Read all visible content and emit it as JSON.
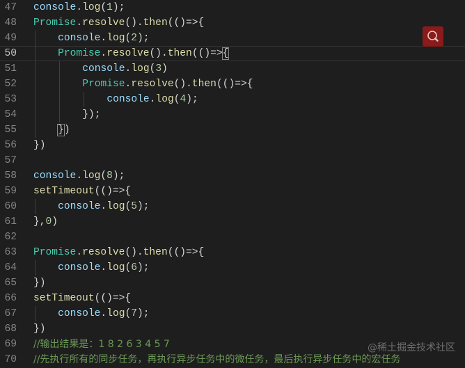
{
  "editor": {
    "current_line": 50,
    "lines": [
      {
        "num": 47,
        "indent": 0,
        "tokens": [
          [
            "console",
            "var"
          ],
          [
            ".",
            "pun"
          ],
          [
            "log",
            "fn"
          ],
          [
            "(",
            "pun"
          ],
          [
            "1",
            "num"
          ],
          [
            ");",
            "pun"
          ]
        ]
      },
      {
        "num": 48,
        "indent": 0,
        "tokens": [
          [
            "Promise",
            "cls"
          ],
          [
            ".",
            "pun"
          ],
          [
            "resolve",
            "fn"
          ],
          [
            "().",
            "pun"
          ],
          [
            "then",
            "fn"
          ],
          [
            "(()",
            "pun"
          ],
          [
            "=>",
            "op"
          ],
          [
            "{",
            "pun"
          ]
        ]
      },
      {
        "num": 49,
        "indent": 1,
        "tokens": [
          [
            "console",
            "var"
          ],
          [
            ".",
            "pun"
          ],
          [
            "log",
            "fn"
          ],
          [
            "(",
            "pun"
          ],
          [
            "2",
            "num"
          ],
          [
            ");",
            "pun"
          ]
        ]
      },
      {
        "num": 50,
        "indent": 1,
        "tokens": [
          [
            "Promise",
            "cls"
          ],
          [
            ".",
            "pun"
          ],
          [
            "resolve",
            "fn"
          ],
          [
            "().",
            "pun"
          ],
          [
            "then",
            "fn"
          ],
          [
            "(()",
            "pun"
          ],
          [
            "=>",
            "op"
          ],
          [
            "{",
            "pun",
            "match"
          ]
        ]
      },
      {
        "num": 51,
        "indent": 2,
        "tokens": [
          [
            "console",
            "var"
          ],
          [
            ".",
            "pun"
          ],
          [
            "log",
            "fn"
          ],
          [
            "(",
            "pun"
          ],
          [
            "3",
            "num"
          ],
          [
            ")",
            "pun"
          ]
        ]
      },
      {
        "num": 52,
        "indent": 2,
        "tokens": [
          [
            "Promise",
            "cls"
          ],
          [
            ".",
            "pun"
          ],
          [
            "resolve",
            "fn"
          ],
          [
            "().",
            "pun"
          ],
          [
            "then",
            "fn"
          ],
          [
            "(()",
            "pun"
          ],
          [
            "=>",
            "op"
          ],
          [
            "{",
            "pun"
          ]
        ]
      },
      {
        "num": 53,
        "indent": 3,
        "tokens": [
          [
            "console",
            "var"
          ],
          [
            ".",
            "pun"
          ],
          [
            "log",
            "fn"
          ],
          [
            "(",
            "pun"
          ],
          [
            "4",
            "num"
          ],
          [
            ");",
            "pun"
          ]
        ]
      },
      {
        "num": 54,
        "indent": 2,
        "tokens": [
          [
            "});",
            "pun"
          ]
        ]
      },
      {
        "num": 55,
        "indent": 1,
        "tokens": [
          [
            "}",
            "pun",
            "match"
          ],
          [
            ")",
            "pun"
          ]
        ]
      },
      {
        "num": 56,
        "indent": 0,
        "tokens": [
          [
            "})",
            "pun"
          ]
        ]
      },
      {
        "num": 57,
        "indent": 0,
        "tokens": []
      },
      {
        "num": 58,
        "indent": 0,
        "tokens": [
          [
            "console",
            "var"
          ],
          [
            ".",
            "pun"
          ],
          [
            "log",
            "fn"
          ],
          [
            "(",
            "pun"
          ],
          [
            "8",
            "num"
          ],
          [
            ");",
            "pun"
          ]
        ]
      },
      {
        "num": 59,
        "indent": 0,
        "tokens": [
          [
            "setTimeout",
            "fn"
          ],
          [
            "(()",
            "pun"
          ],
          [
            "=>",
            "op"
          ],
          [
            "{",
            "pun"
          ]
        ]
      },
      {
        "num": 60,
        "indent": 1,
        "tokens": [
          [
            "console",
            "var"
          ],
          [
            ".",
            "pun"
          ],
          [
            "log",
            "fn"
          ],
          [
            "(",
            "pun"
          ],
          [
            "5",
            "num"
          ],
          [
            ");",
            "pun"
          ]
        ]
      },
      {
        "num": 61,
        "indent": 0,
        "tokens": [
          [
            "},",
            "pun"
          ],
          [
            "0",
            "num"
          ],
          [
            ")",
            "pun"
          ]
        ]
      },
      {
        "num": 62,
        "indent": 0,
        "tokens": []
      },
      {
        "num": 63,
        "indent": 0,
        "tokens": [
          [
            "Promise",
            "cls"
          ],
          [
            ".",
            "pun"
          ],
          [
            "resolve",
            "fn"
          ],
          [
            "().",
            "pun"
          ],
          [
            "then",
            "fn"
          ],
          [
            "(()",
            "pun"
          ],
          [
            "=>",
            "op"
          ],
          [
            "{",
            "pun"
          ]
        ]
      },
      {
        "num": 64,
        "indent": 1,
        "tokens": [
          [
            "console",
            "var"
          ],
          [
            ".",
            "pun"
          ],
          [
            "log",
            "fn"
          ],
          [
            "(",
            "pun"
          ],
          [
            "6",
            "num"
          ],
          [
            ");",
            "pun"
          ]
        ]
      },
      {
        "num": 65,
        "indent": 0,
        "tokens": [
          [
            "})",
            "pun"
          ]
        ]
      },
      {
        "num": 66,
        "indent": 0,
        "tokens": [
          [
            "setTimeout",
            "fn"
          ],
          [
            "(()",
            "pun"
          ],
          [
            "=>",
            "op"
          ],
          [
            "{",
            "pun"
          ]
        ]
      },
      {
        "num": 67,
        "indent": 1,
        "tokens": [
          [
            "console",
            "var"
          ],
          [
            ".",
            "pun"
          ],
          [
            "log",
            "fn"
          ],
          [
            "(",
            "pun"
          ],
          [
            "7",
            "num"
          ],
          [
            ");",
            "pun"
          ]
        ]
      },
      {
        "num": 68,
        "indent": 0,
        "tokens": [
          [
            "})",
            "pun"
          ]
        ]
      },
      {
        "num": 69,
        "indent": 0,
        "tokens": [
          [
            "//输出结果是：1 8 2 6 3 4 5 7",
            "cm"
          ]
        ]
      },
      {
        "num": 70,
        "indent": 0,
        "tokens": [
          [
            "//先执行所有的同步任务，再执行异步任务中的微任务，最后执行异步任务中的宏任务",
            "cm"
          ]
        ]
      }
    ]
  },
  "search_icon": "search-icon",
  "watermark": "@稀土掘金技术社区"
}
